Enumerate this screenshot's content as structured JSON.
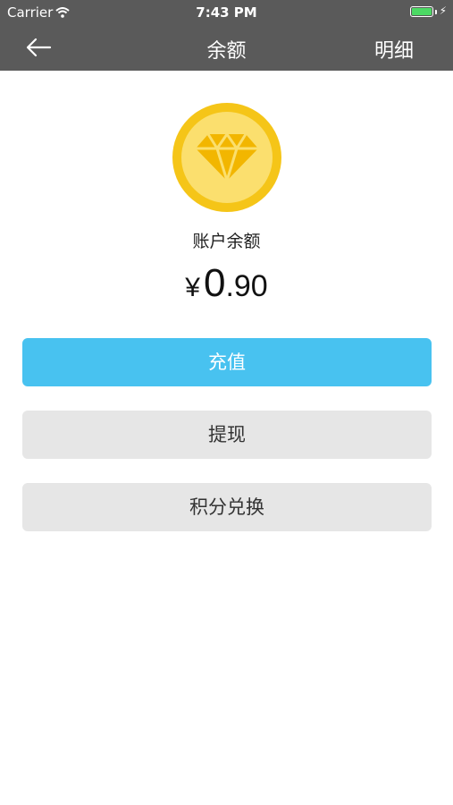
{
  "status_bar": {
    "carrier": "Carrier",
    "time": "7:43 PM",
    "battery_color": "#4cd964"
  },
  "nav": {
    "title": "余额",
    "right_action": "明细",
    "back_icon": "arrow-left-icon"
  },
  "account": {
    "icon": "diamond-icon",
    "label": "账户余额",
    "currency_symbol": "¥",
    "amount_integer": "0",
    "amount_decimal": ".90"
  },
  "actions": {
    "recharge": "充值",
    "withdraw": "提现",
    "points_exchange": "积分兑换"
  },
  "colors": {
    "nav_background": "#5a5a5a",
    "primary_button": "#48c2f0",
    "secondary_button": "#e6e6e6",
    "coin_outer": "#f5c518",
    "coin_inner": "#fbdf6e"
  }
}
